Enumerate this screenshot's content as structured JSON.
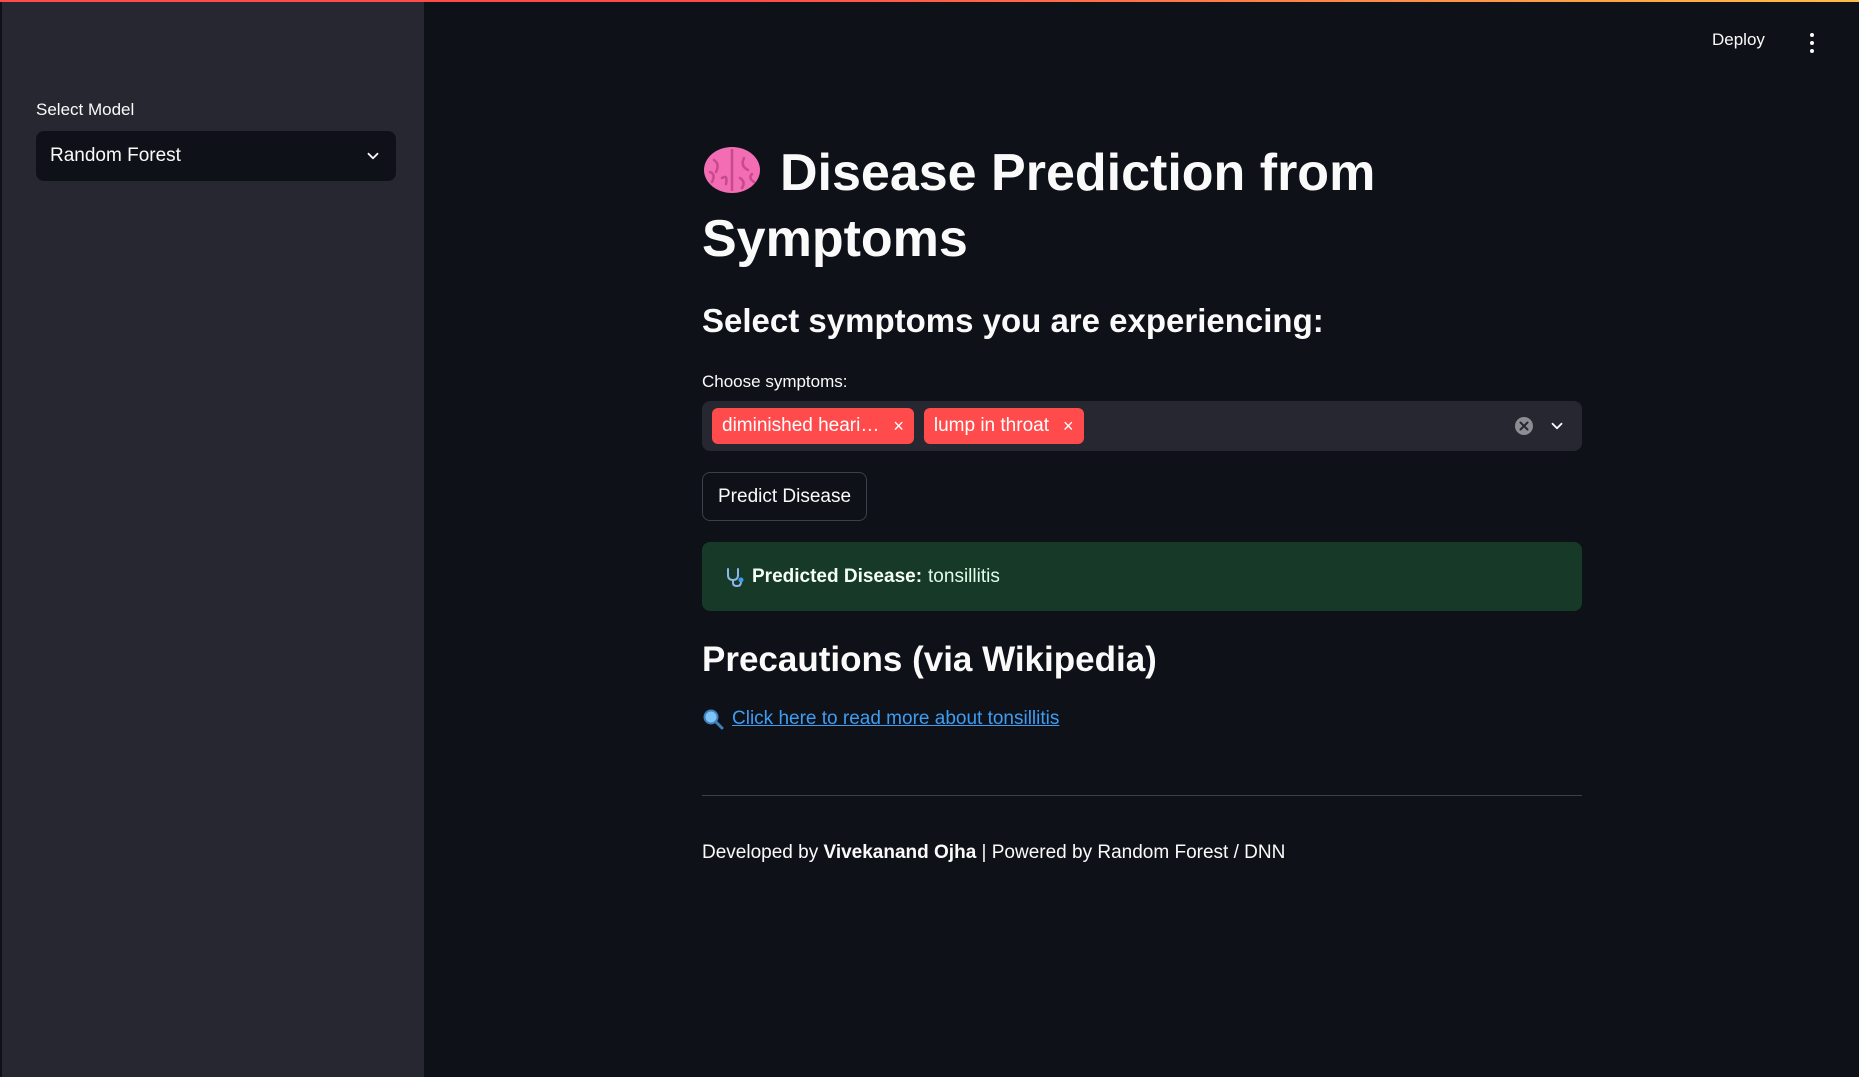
{
  "header": {
    "deploy_label": "Deploy",
    "menu_icon": "vertical-dots-icon"
  },
  "sidebar": {
    "select_label": "Select Model",
    "selected_model": "Random Forest"
  },
  "main": {
    "title": "Disease Prediction from Symptoms",
    "title_icon": "brain-icon",
    "subheader": "Select symptoms you are experiencing:",
    "symptoms_label": "Choose symptoms:",
    "selected_symptoms": [
      "diminished heari…",
      "lump in throat"
    ],
    "tag_close": "×",
    "predict_button": "Predict Disease",
    "result": {
      "label": "Predicted Disease:",
      "value": "tonsillitis",
      "icon": "stethoscope-icon"
    },
    "precautions_header": "Precautions (via Wikipedia)",
    "wiki_link_text": "Click here to read more about tonsillitis",
    "wiki_icon": "magnifier-icon"
  },
  "footer": {
    "prefix": "Developed by",
    "author": "Vivekanand Ojha",
    "suffix": "| Powered by Random Forest / DNN"
  },
  "colors": {
    "accent": "#ff4b4b",
    "background": "#0e1117",
    "sidebar": "#262730",
    "success_bg": "#173928",
    "link": "#3d9df3"
  }
}
